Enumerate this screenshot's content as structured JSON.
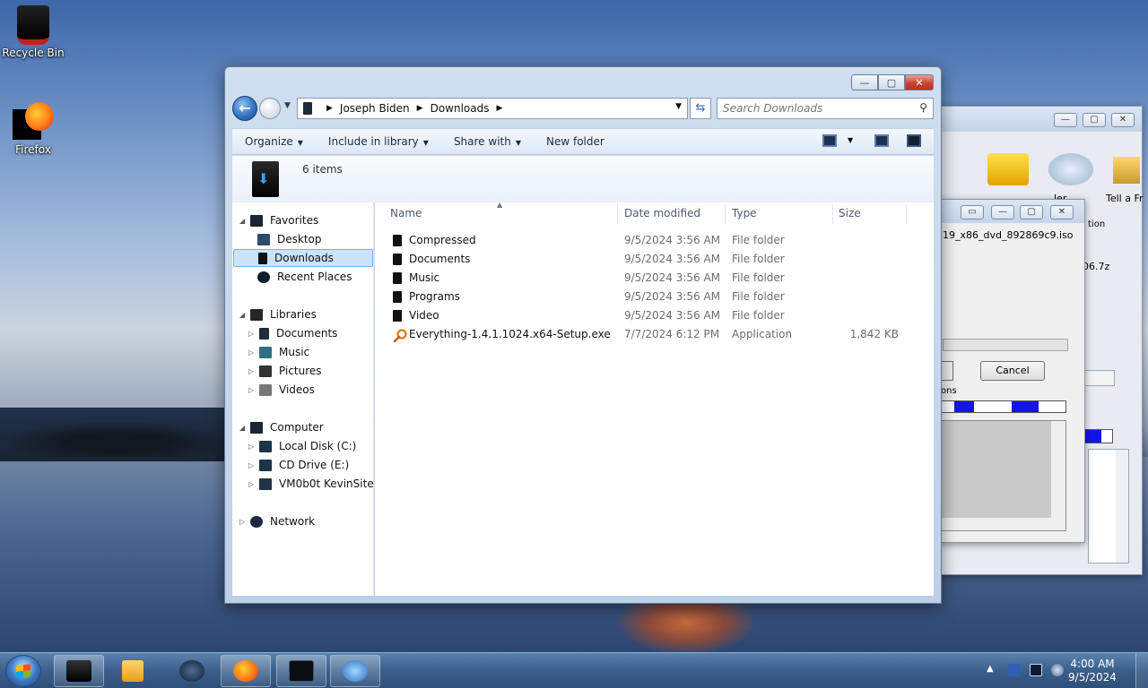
{
  "desktop": {
    "icons": [
      {
        "label": "Recycle Bin"
      },
      {
        "label": "Firefox"
      }
    ]
  },
  "background_windows": {
    "toolbar_labels": [
      "ler",
      "Tell a Fr"
    ],
    "file_text": "19_x86_dvd_892869c9.iso",
    "file_text2": "06.7z",
    "partial_label": "tion",
    "options_label": "ons",
    "cancel_label": "Cancel"
  },
  "explorer": {
    "address": {
      "crumbs": [
        "Joseph Biden",
        "Downloads"
      ]
    },
    "search": {
      "placeholder": "Search Downloads"
    },
    "commands": {
      "organize": "Organize",
      "include": "Include in library",
      "share": "Share with",
      "new_folder": "New folder"
    },
    "details": {
      "item_count": "6 items"
    },
    "nav": {
      "favorites": "Favorites",
      "desktop": "Desktop",
      "downloads": "Downloads",
      "recent": "Recent Places",
      "libraries": "Libraries",
      "lib_documents": "Documents",
      "lib_music": "Music",
      "lib_pictures": "Pictures",
      "lib_videos": "Videos",
      "computer": "Computer",
      "local_disk": "Local Disk (C:)",
      "cd_drive": "CD Drive (E:)",
      "vm_site": "VM0b0t KevinSite",
      "network": "Network"
    },
    "columns": {
      "name": "Name",
      "date": "Date modified",
      "type": "Type",
      "size": "Size"
    },
    "files": [
      {
        "name": "Compressed",
        "date": "9/5/2024 3:56 AM",
        "type": "File folder",
        "size": ""
      },
      {
        "name": "Documents",
        "date": "9/5/2024 3:56 AM",
        "type": "File folder",
        "size": ""
      },
      {
        "name": "Music",
        "date": "9/5/2024 3:56 AM",
        "type": "File folder",
        "size": ""
      },
      {
        "name": "Programs",
        "date": "9/5/2024 3:56 AM",
        "type": "File folder",
        "size": ""
      },
      {
        "name": "Video",
        "date": "9/5/2024 3:56 AM",
        "type": "File folder",
        "size": ""
      },
      {
        "name": "Everything-1.4.1.1024.x64-Setup.exe",
        "date": "7/7/2024 6:12 PM",
        "type": "Application",
        "size": "1,842 KB"
      }
    ]
  },
  "taskbar": {
    "clock_time": "4:00 AM",
    "clock_date": "9/5/2024"
  }
}
